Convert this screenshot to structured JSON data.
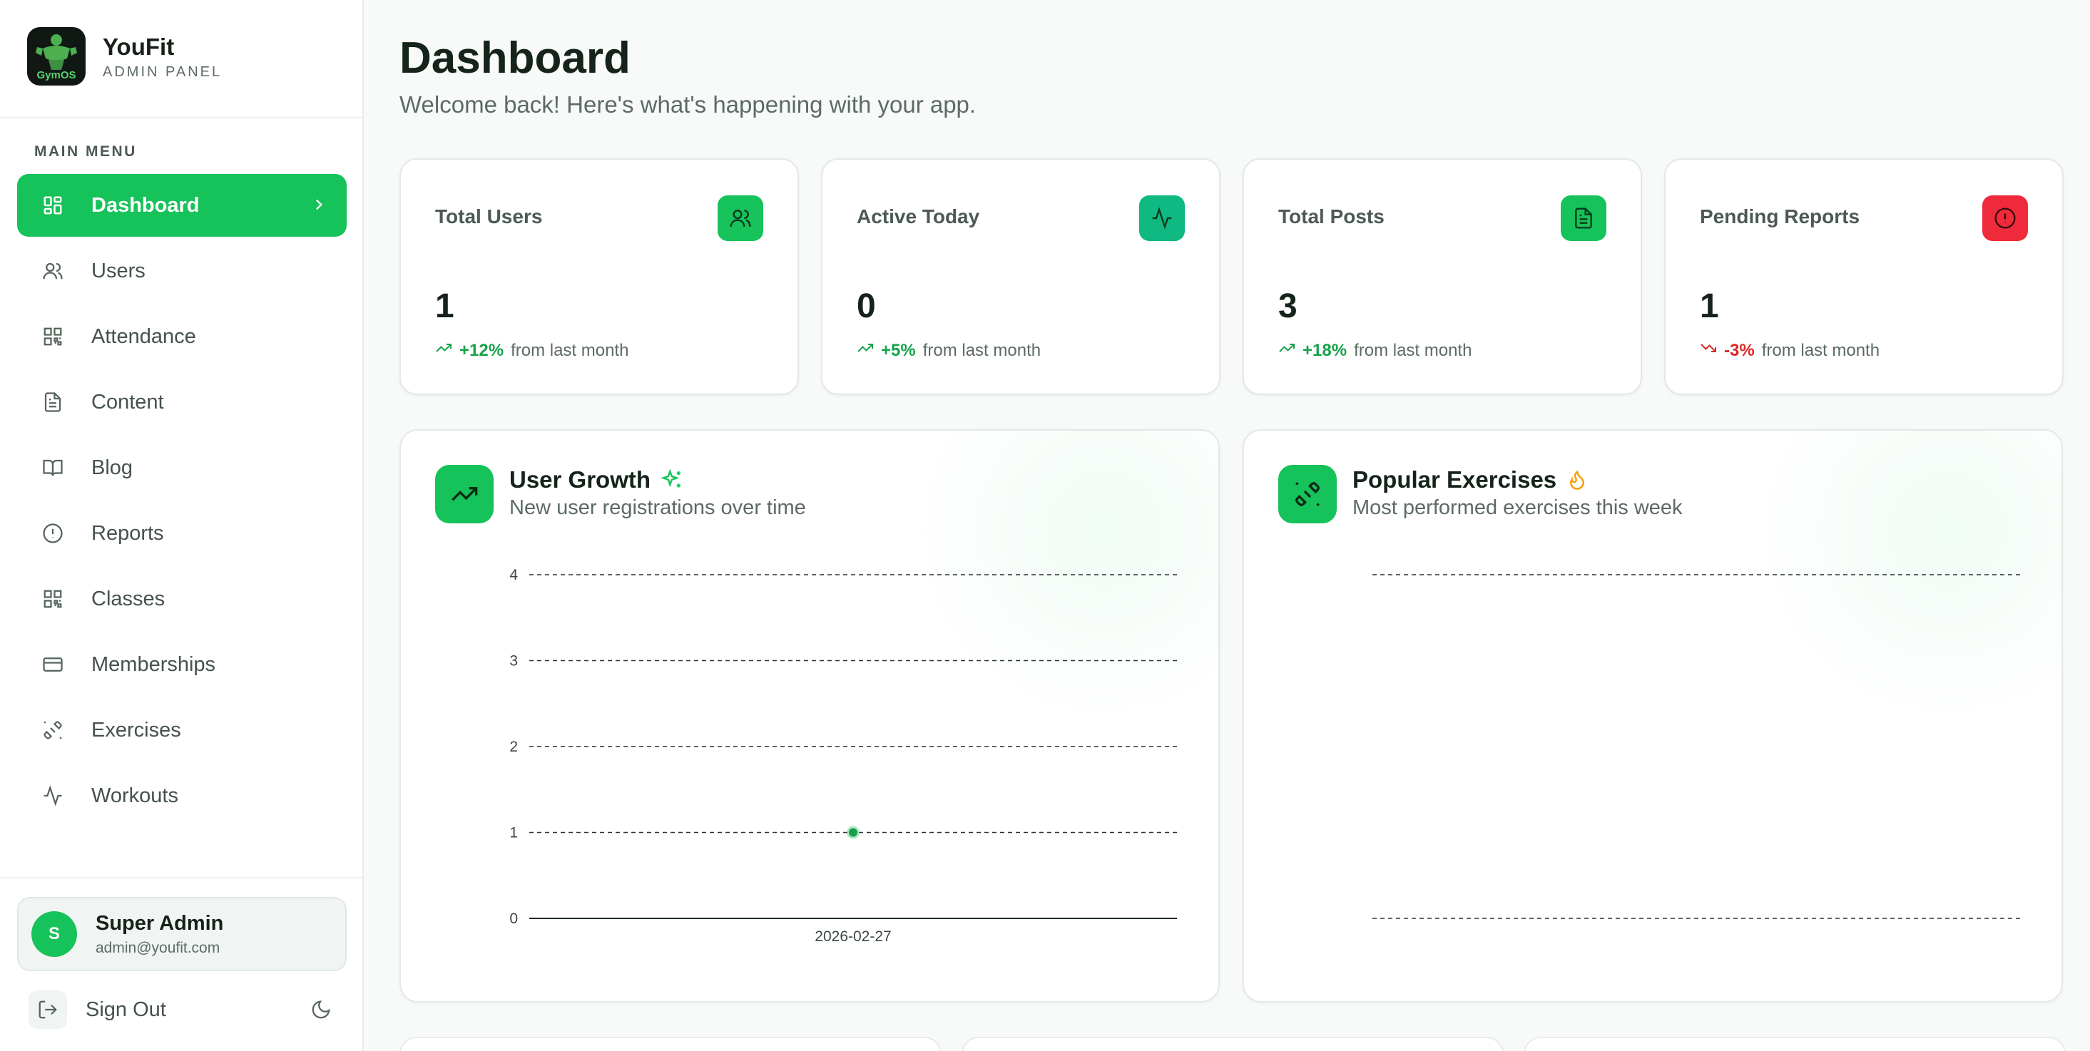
{
  "brand": {
    "name": "YouFit",
    "subtitle": "ADMIN PANEL",
    "logo_text": "GymOS"
  },
  "sidebar": {
    "section_label": "MAIN MENU",
    "items": [
      {
        "label": "Dashboard",
        "icon": "dashboard-grid-icon",
        "active": true
      },
      {
        "label": "Users",
        "icon": "users-icon"
      },
      {
        "label": "Attendance",
        "icon": "qr-code-icon"
      },
      {
        "label": "Content",
        "icon": "document-icon"
      },
      {
        "label": "Blog",
        "icon": "book-open-icon"
      },
      {
        "label": "Reports",
        "icon": "alert-circle-icon"
      },
      {
        "label": "Classes",
        "icon": "qr-code-icon"
      },
      {
        "label": "Memberships",
        "icon": "credit-card-icon"
      },
      {
        "label": "Exercises",
        "icon": "dumbbell-icon"
      },
      {
        "label": "Workouts",
        "icon": "activity-icon"
      }
    ]
  },
  "user": {
    "initial": "S",
    "name": "Super Admin",
    "email": "admin@youfit.com"
  },
  "signout": {
    "label": "Sign Out"
  },
  "page": {
    "title": "Dashboard",
    "subtitle": "Welcome back! Here's what's happening with your app."
  },
  "stats": [
    {
      "title": "Total Users",
      "value": "1",
      "pct": "+12%",
      "suffix": "from last month",
      "trend": "up",
      "icon": "users-icon",
      "color": "#16c25a"
    },
    {
      "title": "Active Today",
      "value": "0",
      "pct": "+5%",
      "suffix": "from last month",
      "trend": "up",
      "icon": "activity-icon",
      "color": "#10b981"
    },
    {
      "title": "Total Posts",
      "value": "3",
      "pct": "+18%",
      "suffix": "from last month",
      "trend": "up",
      "icon": "document-icon",
      "color": "#16c25a"
    },
    {
      "title": "Pending Reports",
      "value": "1",
      "pct": "-3%",
      "suffix": "from last month",
      "trend": "down",
      "icon": "alert-circle-icon",
      "color": "#ef2b3b"
    }
  ],
  "panels": {
    "growth": {
      "title": "User Growth",
      "subtitle": "New user registrations over time"
    },
    "exercises": {
      "title": "Popular Exercises",
      "subtitle": "Most performed exercises this week"
    }
  },
  "colors": {
    "accent": "#16c25a",
    "trend_up": "#16a34a",
    "trend_down": "#dc2626"
  },
  "chart_data": [
    {
      "type": "line",
      "x": [
        "2026-02-27"
      ],
      "series": [
        {
          "values": [
            1
          ]
        }
      ],
      "ylim": [
        0,
        4
      ],
      "yticks": [
        0,
        1,
        2,
        3,
        4
      ],
      "grid": true
    },
    {
      "type": "bar",
      "categories": [],
      "values": [],
      "grid": true
    }
  ]
}
